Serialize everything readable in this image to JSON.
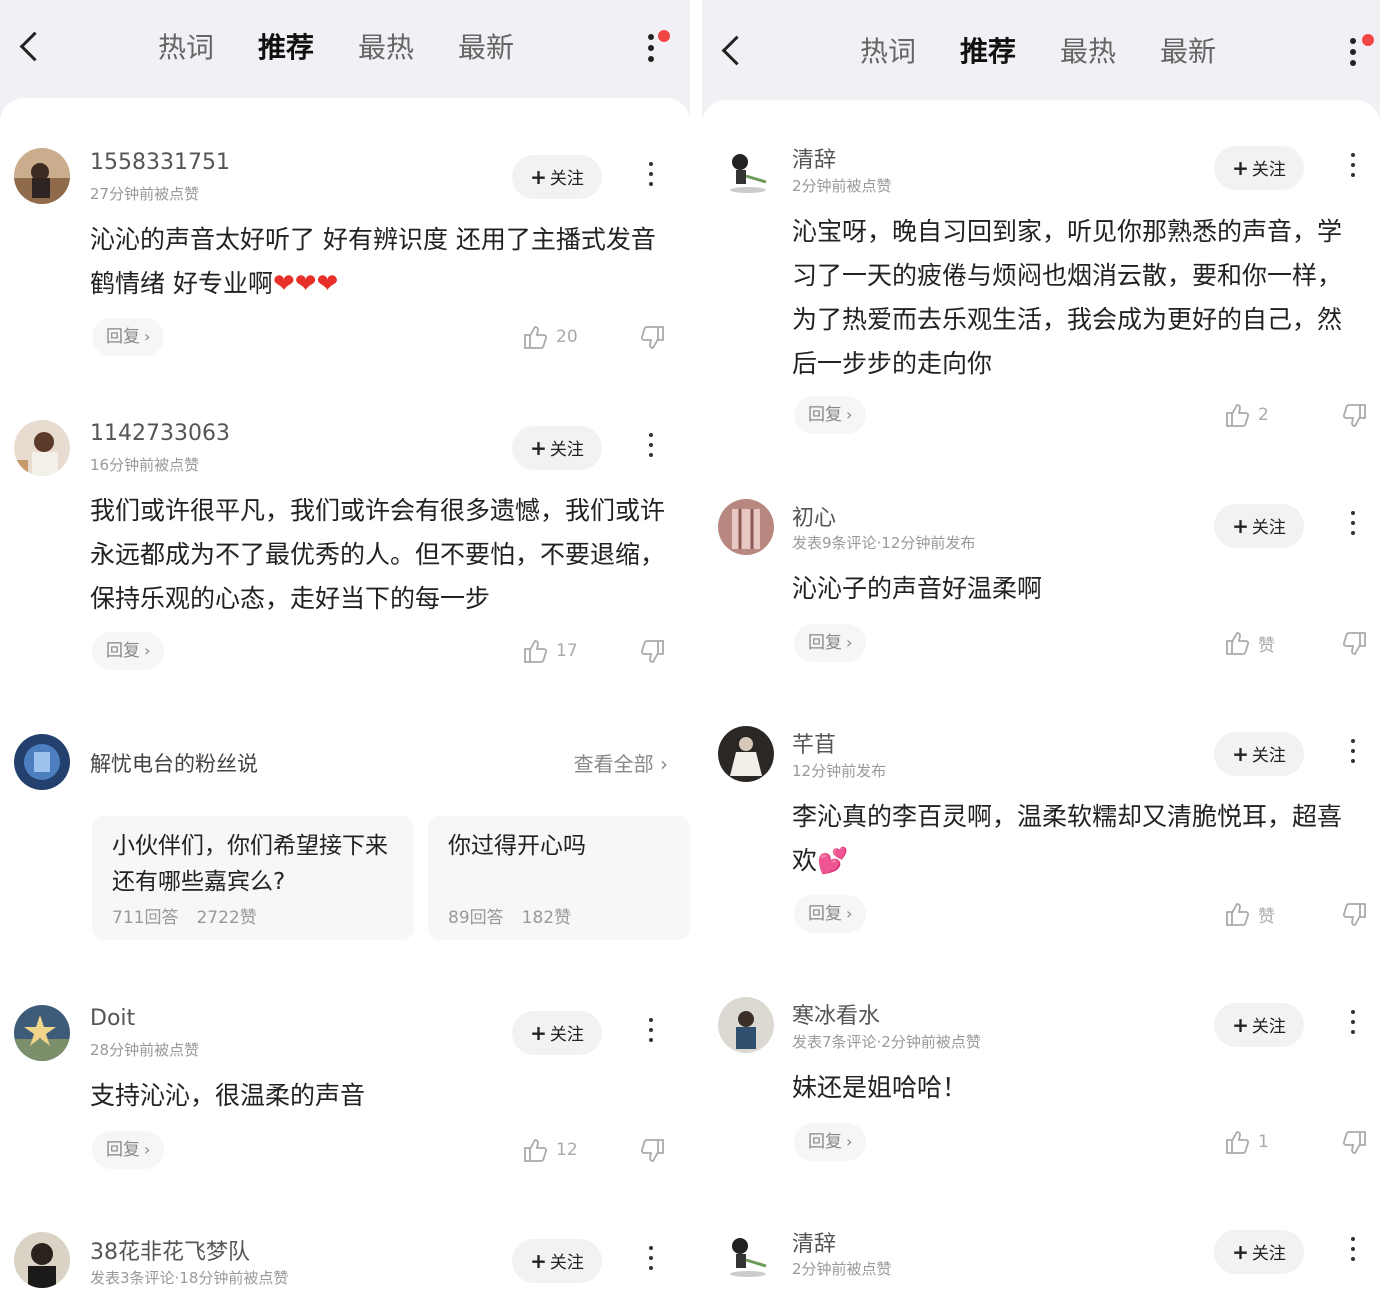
{
  "tabs": [
    "热词",
    "推荐",
    "最热",
    "最新"
  ],
  "active_tab": "推荐",
  "reply_label": "回复",
  "follow_label": "关注",
  "left": {
    "comments": [
      {
        "user": "1558331751",
        "meta": "27分钟前被点赞",
        "text": "沁沁的声音太好听了 好有辨识度 还用了主播式发音鹤情绪 好专业啊",
        "likes": "20",
        "hearts": "❤❤❤"
      },
      {
        "user": "1142733063",
        "meta": "16分钟前被点赞",
        "text": "我们或许很平凡，我们或许会有很多遗憾，我们或许永远都成为不了最优秀的人。但不要怕，不要退缩，保持乐观的心态，走好当下的每一步",
        "likes": "17"
      },
      {
        "user": "Doit",
        "meta": "28分钟前被点赞",
        "text": "支持沁沁，很温柔的声音",
        "likes": "12"
      },
      {
        "user": "38花非花飞梦队",
        "meta": "发表3条评论·18分钟前被点赞"
      }
    ],
    "fans": {
      "title": "解忧电台的粉丝说",
      "view_all": "查看全部",
      "cards": [
        {
          "question": "小伙伴们，你们希望接下来还有哪些嘉宾么?",
          "answers": "711回答",
          "likes": "2722赞"
        },
        {
          "question": "你过得开心吗",
          "answers": "89回答",
          "likes": "182赞"
        }
      ]
    }
  },
  "right": {
    "comments": [
      {
        "user": "清辞",
        "meta": "2分钟前被点赞",
        "text": "沁宝呀，晚自习回到家，听见你那熟悉的声音，学习了一天的疲倦与烦闷也烟消云散，要和你一样，为了热爱而去乐观生活，我会成为更好的自己，然后一步步的走向你",
        "likes": "2"
      },
      {
        "user": "初心",
        "meta": "发表9条评论·12分钟前发布",
        "text": "沁沁子的声音好温柔啊",
        "likes": "赞"
      },
      {
        "user": "芊苜",
        "meta": "12分钟前发布",
        "text": "李沁真的李百灵啊，温柔软糯却又清脆悦耳，超喜欢",
        "emoji": "💕",
        "likes": "赞"
      },
      {
        "user": "寒冰看水",
        "meta": "发表7条评论·2分钟前被点赞",
        "text": "妹还是姐哈哈！",
        "likes": "1"
      },
      {
        "user": "清辞",
        "meta": "2分钟前被点赞"
      }
    ]
  }
}
